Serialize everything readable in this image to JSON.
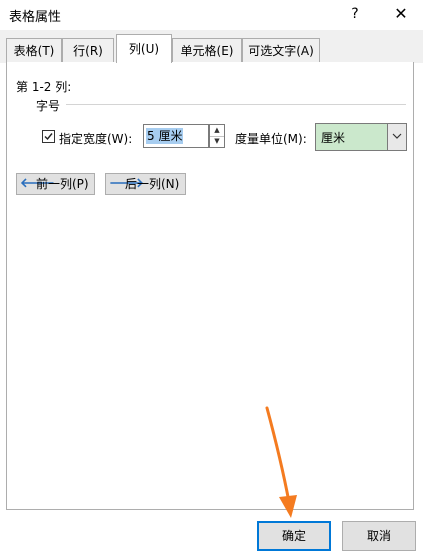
{
  "window": {
    "title": "表格属性",
    "help_label": "?",
    "close_label": "✕"
  },
  "tabs": [
    {
      "label": "表格(T)"
    },
    {
      "label": "行(R)"
    },
    {
      "label": "列(U)"
    },
    {
      "label": "单元格(E)"
    },
    {
      "label": "可选文字(A)"
    }
  ],
  "column_tab": {
    "section_label": "第 1-2 列:",
    "group_label": "字号",
    "specify_width": {
      "label": "指定宽度(W):",
      "checked": true
    },
    "width_value": "5 厘米",
    "unit_label": "度量单位(M):",
    "unit_value": "厘米",
    "prev_label": "前一列(P)",
    "next_label": "后一列(N)"
  },
  "footer": {
    "ok_label": "确定",
    "cancel_label": "取消"
  },
  "colors": {
    "accent": "#0078d7",
    "annotation": "#f47b20",
    "selection": "#a7cdf0",
    "select_bg": "#cbe8cc"
  },
  "icons": {
    "check": "checkmark-icon",
    "spin_up": "spin-up-icon",
    "spin_down": "spin-down-icon",
    "dropdown": "chevron-down-icon",
    "prev": "arrow-left-icon",
    "next": "arrow-right-icon"
  }
}
